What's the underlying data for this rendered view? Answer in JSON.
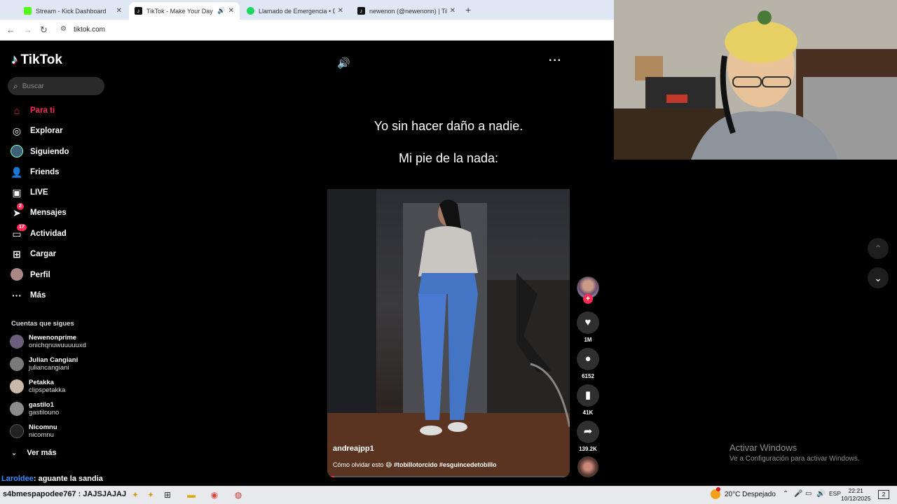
{
  "browser": {
    "tabs": [
      {
        "title": "Stream - Kick Dashboard",
        "favicon_color": "#53fc18",
        "active": false
      },
      {
        "title": "TikTok - Make Your Day",
        "favicon_color": "#111111",
        "active": true
      },
      {
        "title": "Llamado de Emergencia • Dad",
        "favicon_color": "#1ed760",
        "active": false
      },
      {
        "title": "newenon (@newenonn) | TikTo",
        "favicon_color": "#111111",
        "active": false
      }
    ],
    "url": "tiktok.com"
  },
  "tiktok": {
    "logo": "TikTok",
    "search_placeholder": "Buscar",
    "nav": [
      {
        "label": "Para ti",
        "icon": "home-icon",
        "active": true
      },
      {
        "label": "Explorar",
        "icon": "compass-icon"
      },
      {
        "label": "Siguiendo",
        "icon": "following-avatar-icon"
      },
      {
        "label": "Friends",
        "icon": "friends-icon"
      },
      {
        "label": "LIVE",
        "icon": "live-icon"
      },
      {
        "label": "Mensajes",
        "icon": "messages-icon",
        "badge": "2"
      },
      {
        "label": "Actividad",
        "icon": "activity-icon",
        "badge": "17"
      },
      {
        "label": "Cargar",
        "icon": "upload-icon"
      },
      {
        "label": "Perfil",
        "icon": "profile-avatar-icon"
      },
      {
        "label": "Más",
        "icon": "more-dots-icon"
      }
    ],
    "following_title": "Cuentas que sigues",
    "following": [
      {
        "name": "Newenonprime",
        "handle": "onichqnuwuuuuuxd",
        "avatar_color": "#6a5f7a"
      },
      {
        "name": "Julian Cangiani",
        "handle": "juliancangiani",
        "avatar_color": "#7a7a7a"
      },
      {
        "name": "Petakka",
        "handle": "clipspetakka",
        "avatar_color": "#c9b9a8"
      },
      {
        "name": "gastilo1",
        "handle": "gastilouno",
        "avatar_color": "#8c8c8c"
      },
      {
        "name": "Nicomnu",
        "handle": "nicomnu",
        "avatar_color": "#222222"
      }
    ],
    "see_more": "Ver más",
    "video": {
      "caption_line1": "Yo sin hacer daño a nadie.",
      "caption_line2": "Mi pie de la nada:",
      "author": "andreajpp1",
      "description": "Cómo olvidar esto 😅",
      "hashtags": "#tobillotorcido #esguincedetobillo",
      "progress": 0.03
    },
    "actions": {
      "likes": "1M",
      "comments": "6152",
      "saves": "41K",
      "shares": "139.2K"
    }
  },
  "windows_watermark": {
    "line1": "Activar Windows",
    "line2": "Ve a Configuración para activar Windows."
  },
  "stream_chat": {
    "user": "Laroldee",
    "message": ": aguante la sandia",
    "line2": "s4bmespapodee767 : JAJSJAJAJ"
  },
  "taskbar": {
    "weather": "20°C  Despejado",
    "language": "ESP",
    "time": "22:21",
    "date": "10/12/2025"
  }
}
